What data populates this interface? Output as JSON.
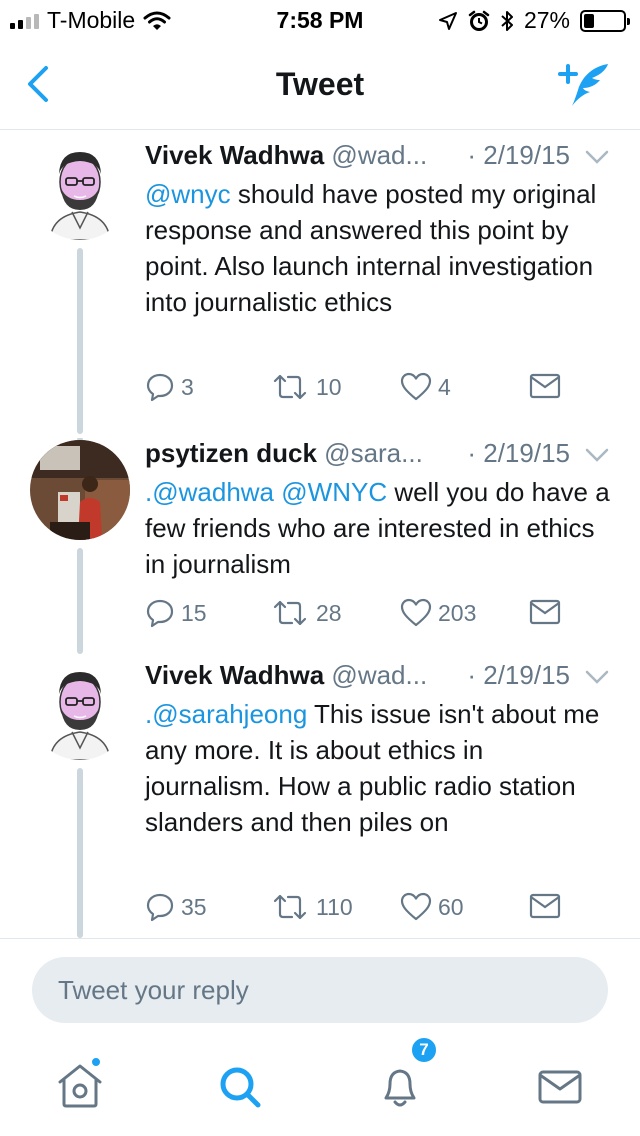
{
  "status_bar": {
    "carrier": "T-Mobile",
    "time": "7:58 PM",
    "battery_percent": "27%",
    "battery_level": 0.27,
    "signal_bars_filled": 2,
    "icons": [
      "wifi-icon",
      "location-arrow-icon",
      "alarm-icon",
      "bluetooth-icon",
      "battery-icon"
    ]
  },
  "nav": {
    "title": "Tweet",
    "back_icon": "chevron-left-icon",
    "compose_icon": "compose-tweet-icon"
  },
  "colors": {
    "accent": "#1da1f2",
    "mention": "#1b95e0",
    "text": "#14171a",
    "secondary": "#657786",
    "thread_line": "#ccd6dd",
    "divider": "#e1e8ed"
  },
  "tweets": [
    {
      "name": "Vivek Wadhwa",
      "handle": "@wad...",
      "date": "· 2/19/15",
      "body_mention": "@wnyc",
      "body_text": " should have posted my original response and answered this point by point. Also launch internal investigation into journalistic ethics",
      "replies": "3",
      "retweets": "10",
      "likes": "4"
    },
    {
      "name": "psytizen duck",
      "handle": "@sara...",
      "date": "· 2/19/15",
      "body_prefix": ".",
      "body_mention": "@wadhwa",
      "body_mention2": "@WNYC",
      "body_text": " well you do have a few friends who are interested in ethics in journalism",
      "replies": "15",
      "retweets": "28",
      "likes": "203"
    },
    {
      "name": "Vivek Wadhwa",
      "handle": "@wad...",
      "date": "· 2/19/15",
      "body_prefix": ".",
      "body_mention": "@sarahjeong",
      "body_text": " This issue isn't about me any more. It is about ethics in journalism. How a public radio station slanders and then piles on",
      "replies": "35",
      "retweets": "110",
      "likes": "60"
    }
  ],
  "reply": {
    "placeholder": "Tweet your reply"
  },
  "tab_bar": {
    "items": [
      "home-icon",
      "search-icon",
      "notifications-icon",
      "messages-icon"
    ],
    "notifications_badge": "7"
  }
}
